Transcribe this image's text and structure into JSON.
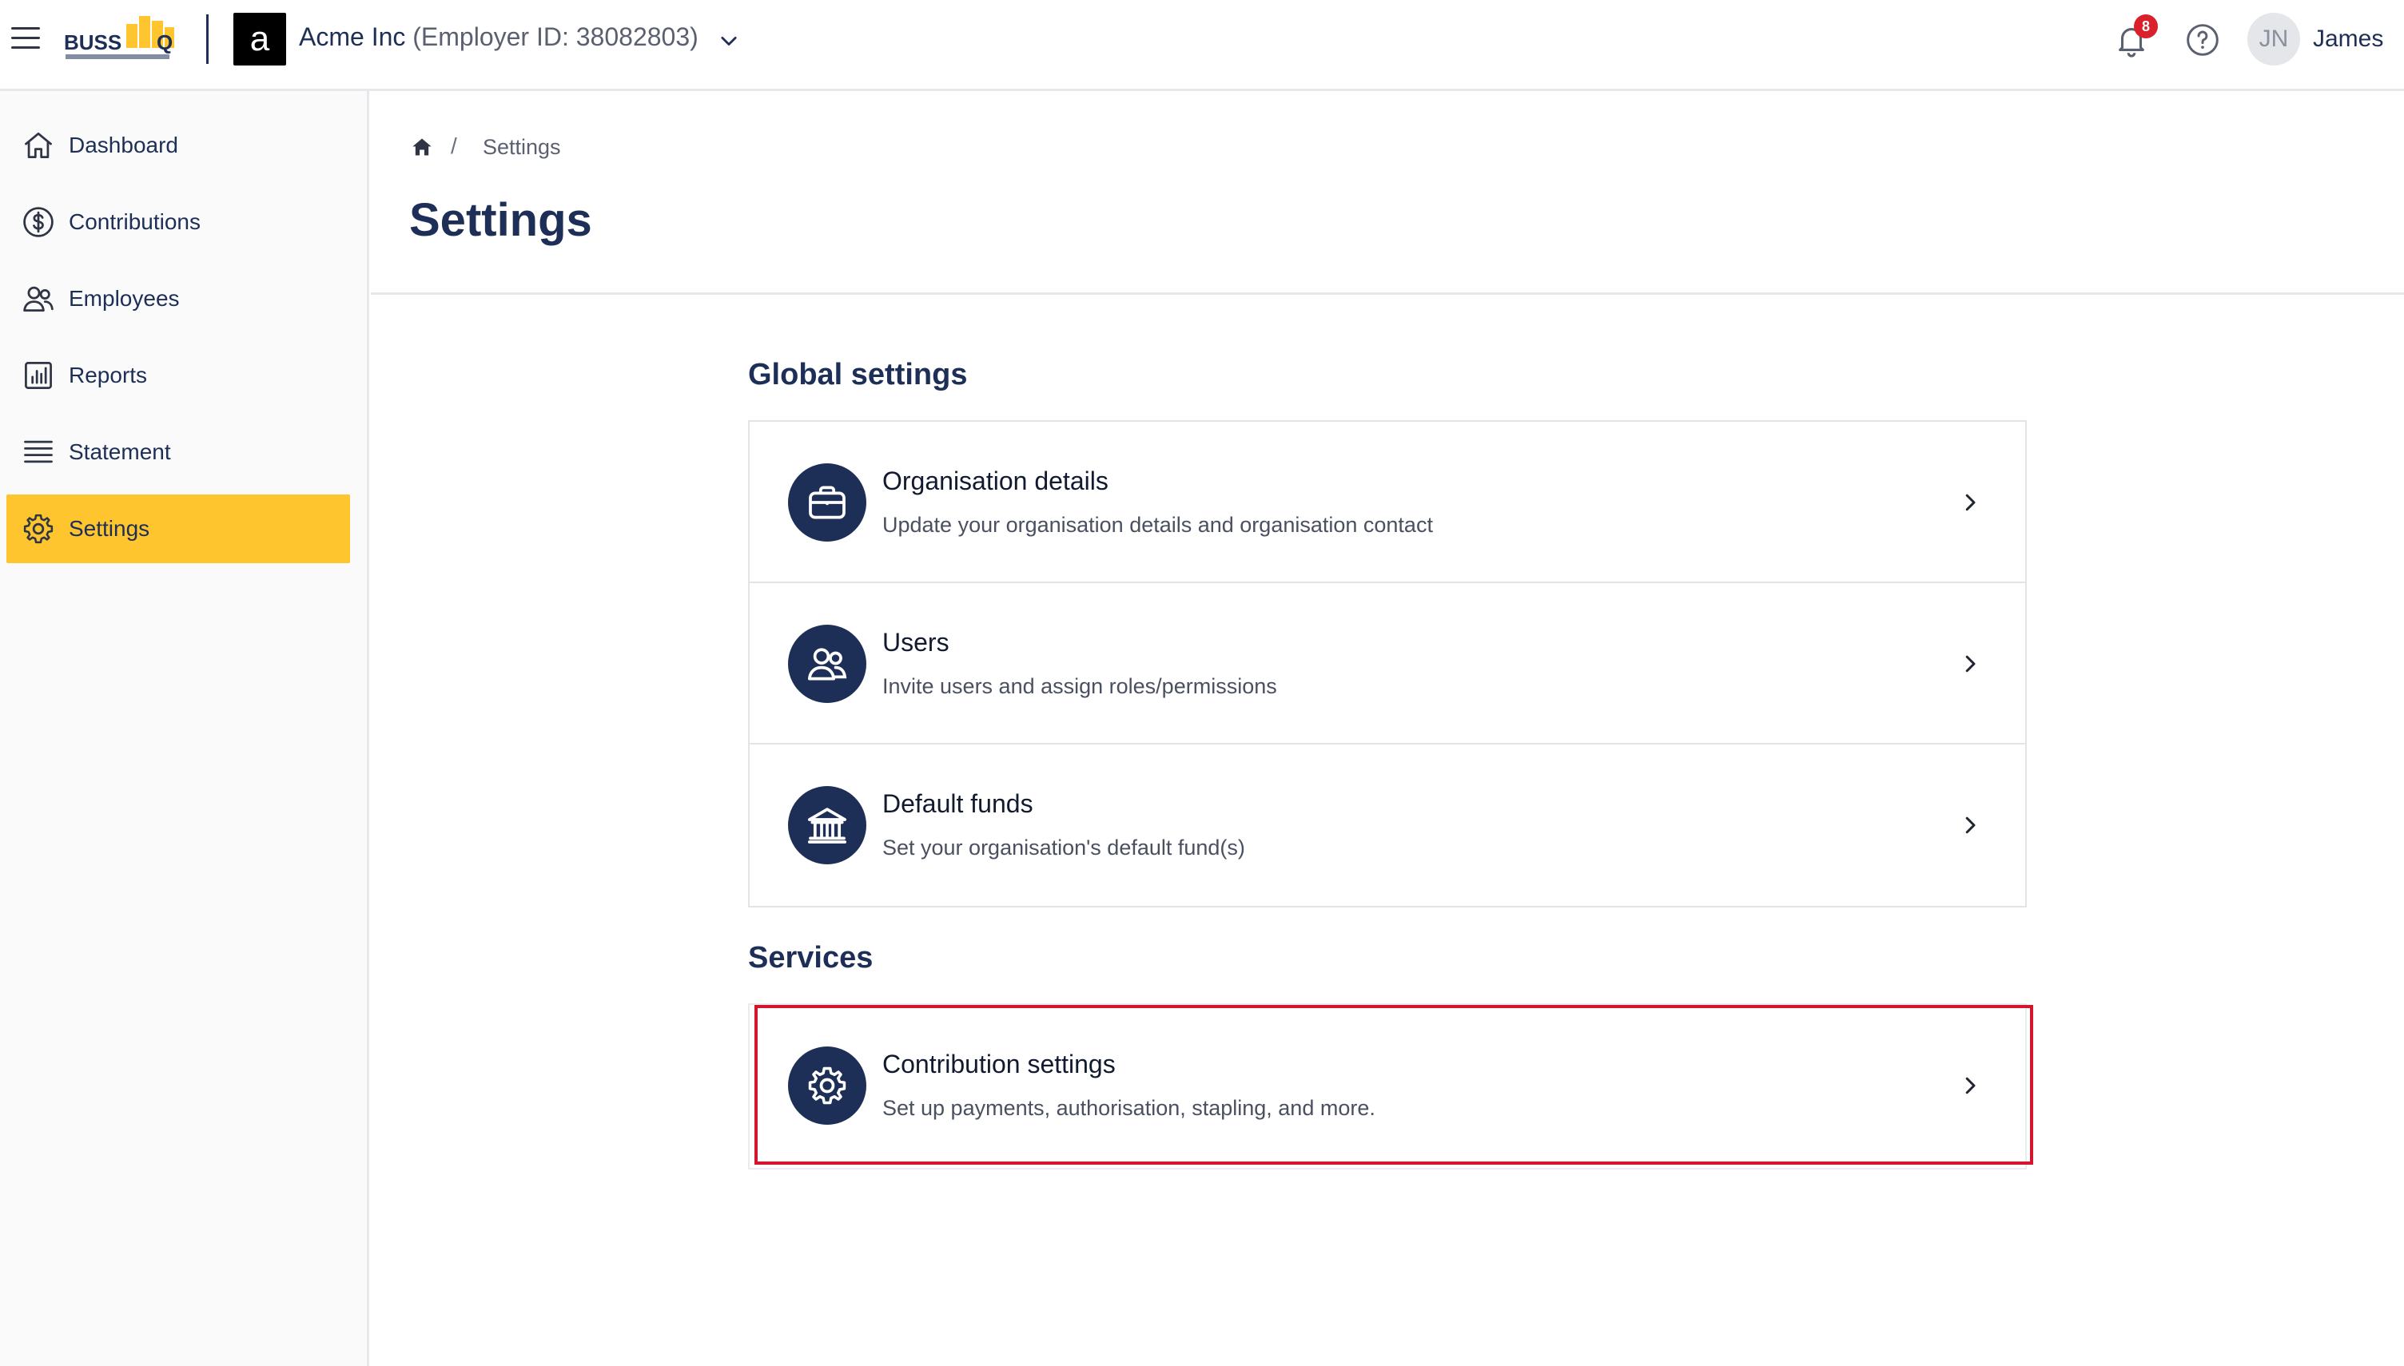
{
  "topbar": {
    "org_letter": "a",
    "org_name": "Acme Inc",
    "employer_id": "(Employer ID: 38082803)",
    "notification_count": "8",
    "avatar_initials": "JN",
    "user_name": "James"
  },
  "sidebar": {
    "items": [
      {
        "label": "Dashboard",
        "icon": "home-icon"
      },
      {
        "label": "Contributions",
        "icon": "dollar-circle-icon"
      },
      {
        "label": "Employees",
        "icon": "users-icon"
      },
      {
        "label": "Reports",
        "icon": "report-chart-icon"
      },
      {
        "label": "Statement",
        "icon": "statement-list-icon"
      },
      {
        "label": "Settings",
        "icon": "gear-icon",
        "active": true
      }
    ]
  },
  "breadcrumb": {
    "separator": "/",
    "current": "Settings"
  },
  "page_title": "Settings",
  "global_settings": {
    "title": "Global settings",
    "rows": [
      {
        "title": "Organisation details",
        "desc": "Update your organisation details and organisation contact",
        "icon": "briefcase-icon"
      },
      {
        "title": "Users",
        "desc": "Invite users and assign roles/permissions",
        "icon": "users-icon"
      },
      {
        "title": "Default funds",
        "desc": "Set your organisation's default fund(s)",
        "icon": "bank-icon"
      }
    ]
  },
  "services": {
    "title": "Services",
    "rows": [
      {
        "title": "Contribution settings",
        "desc": "Set up payments, authorisation, stapling, and more.",
        "icon": "gear-icon"
      }
    ]
  },
  "colors": {
    "navy": "#1e2f57",
    "accent_yellow": "#fec52e",
    "highlight_red": "#d4152b",
    "badge_red": "#d9202b"
  }
}
